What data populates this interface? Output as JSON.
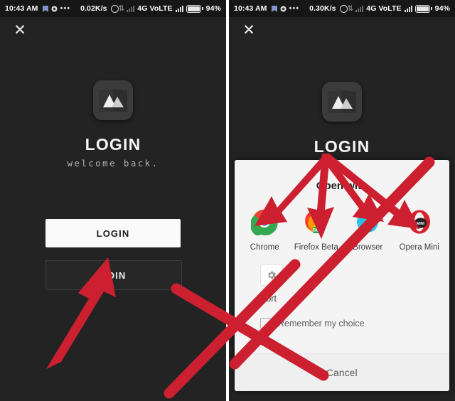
{
  "colors": {
    "annotation_red": "#cc2030",
    "panel_bg": "#232323",
    "statusbar_bg": "#161616",
    "dialog_bg": "#f4f4f4",
    "login_button_bg": "#fafafa"
  },
  "panels": [
    {
      "id": "left",
      "statusbar": {
        "time": "10:43 AM",
        "dots": "•••",
        "speed": "0.02K/s",
        "network": "4G VoLTE",
        "battery": "94%"
      },
      "close_label": "✕",
      "app": {
        "title": "LOGIN",
        "subtitle": "welcome back."
      },
      "buttons": [
        {
          "label": "LOGIN",
          "style": "primary"
        },
        {
          "label": "JOIN",
          "style": "outline"
        }
      ]
    },
    {
      "id": "right",
      "statusbar": {
        "time": "10:43 AM",
        "dots": "•••",
        "speed": "0.30K/s",
        "network": "4G VoLTE",
        "battery": "94%"
      },
      "close_label": "✕",
      "app": {
        "title": "LOGIN",
        "subtitle": ""
      },
      "dialog": {
        "title": "Open with",
        "apps": [
          {
            "name": "Chrome",
            "icon": "chrome-icon"
          },
          {
            "name": "Firefox Beta",
            "icon": "firefox-beta-icon"
          },
          {
            "name": "Browser",
            "icon": "browser-icon"
          },
          {
            "name": "Opera Mini",
            "icon": "opera-mini-icon"
          }
        ],
        "sort_label": "Sort",
        "sort_icon": "gear-icon",
        "remember_label": "Remember my choice",
        "remember_checked": false,
        "cancel_label": "Cancel"
      }
    }
  ],
  "annotations": {
    "left_arrow": "red-arrow-pointing-up-right-to-join-button",
    "right_arrows": "four-red-arrows-fanning-down-to-browser-icons",
    "cross_out": "large-red-x-over-dialog-and-left-panel"
  }
}
